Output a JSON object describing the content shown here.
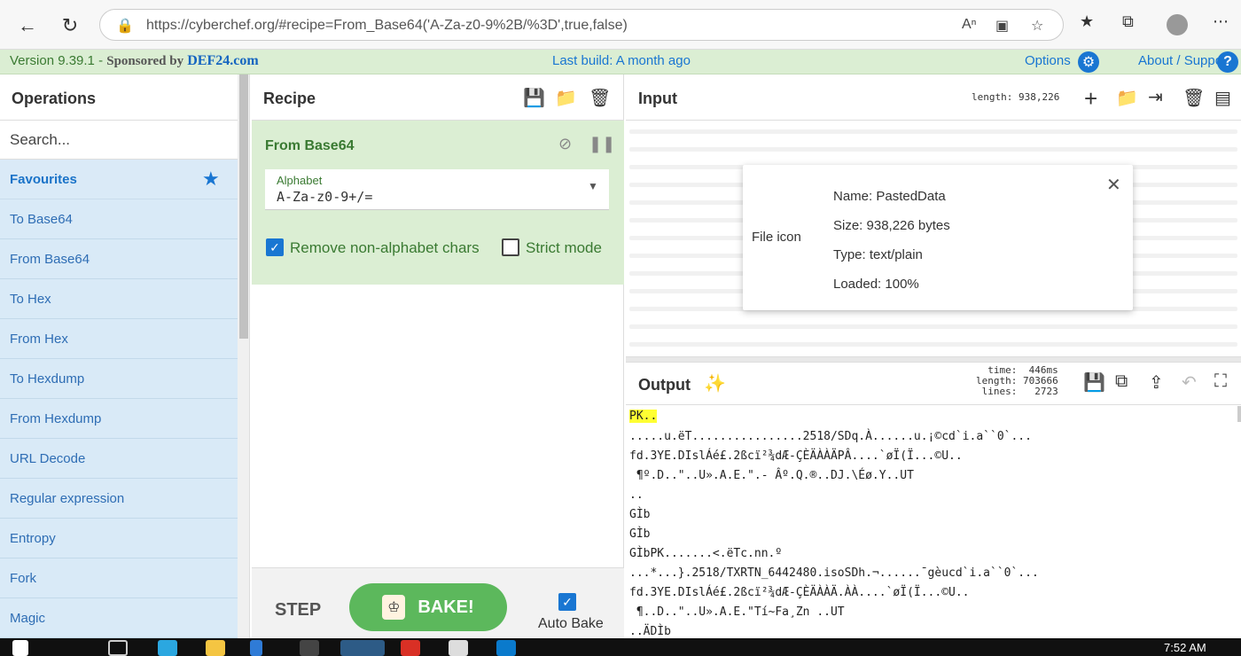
{
  "browser": {
    "url": "https://cyberchef.org/#recipe=From_Base64('A-Za-z0-9%2B/%3D',true,false)"
  },
  "banner": {
    "version": "Version 9.39.1 - ",
    "sponsored": "Sponsored by",
    "sponsor": "DEF24.com",
    "last_build": "Last build: A month ago",
    "options": "Options",
    "about": "About / Support"
  },
  "operations": {
    "title": "Operations",
    "search_placeholder": "Search...",
    "favourites": "Favourites",
    "items": [
      "To Base64",
      "From Base64",
      "To Hex",
      "From Hex",
      "To Hexdump",
      "From Hexdump",
      "URL Decode",
      "Regular expression",
      "Entropy",
      "Fork",
      "Magic"
    ]
  },
  "recipe": {
    "title": "Recipe",
    "op_name": "From Base64",
    "alphabet_label": "Alphabet",
    "alphabet_value": "A-Za-z0-9+/=",
    "remove_nonalpha": "Remove non-alphabet chars",
    "remove_nonalpha_checked": true,
    "strict_mode": "Strict mode",
    "strict_mode_checked": false,
    "step": "STEP",
    "bake": "BAKE!",
    "auto_bake": "Auto Bake",
    "auto_bake_checked": true
  },
  "input": {
    "title": "Input",
    "length": "length: 938,226",
    "file": {
      "icon_alt": "File icon",
      "name": "Name: PastedData",
      "size": "Size: 938,226 bytes",
      "type": "Type: text/plain",
      "loaded": "Loaded: 100%"
    }
  },
  "output": {
    "title": "Output",
    "stats": "time:  446ms\nlength: 703666\nlines:   2723",
    "lines": [
      "PK..",
      ".....u.ëT................2518/SDq.À......u.¡©cd`i.a``0`...",
      "fd.3YE.DIslÁé£.2ßcï²¾dÆ-ÇÈÄÀÀÄPÂ....`øÏ(Ï...©U..",
      " ¶º.D..\"..U».A.E.\".- Âº.Q.®..DJ.\\Éø.Y..UT",
      "..",
      "GÌb",
      "GÌb",
      "GÌbPK.......<.ëTc.nn.º",
      "...*...}.2518/TXRTN_6442480.isoSDh.¬......¯gèucd`i.a``0`...",
      "fd.3YE.DIslÁé£.2ßcï²¾dÆ-ÇÈÄÀÀÄ.ÀÀ....`øÏ(Ï...©U..",
      " ¶..D..\"..U».A.E.\"Tí~Fa¸Zn ..UT",
      "..ÄDÌb"
    ]
  },
  "taskbar": {
    "time": "7:52 AM"
  }
}
